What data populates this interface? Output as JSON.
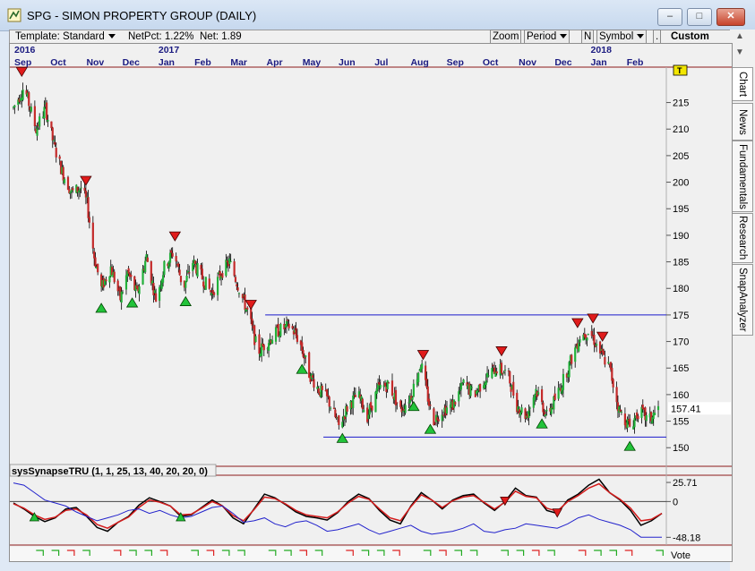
{
  "window": {
    "title": "SPG - SIMON PROPERTY GROUP (DAILY)",
    "minimize_label": "‒",
    "maximize_label": "□",
    "close_label": "✕"
  },
  "toolbar": {
    "template_label": "Template: Standard",
    "netpct_label": "NetPct: 1.22%",
    "net_label": "Net: 1.89",
    "zoom_label": "Zoom",
    "period_label": "Period",
    "n_label": "N",
    "symbol_label": "Symbol",
    "dot_label": ".",
    "custom_label": "Custom"
  },
  "side_tabs": [
    "Chart",
    "News",
    "Fundamentals",
    "Research",
    "SnapAnalyzer"
  ],
  "top_axis": {
    "years": [
      {
        "label": "2016",
        "index": 0
      },
      {
        "label": "2017",
        "index": 4
      },
      {
        "label": "2018",
        "index": 16
      }
    ],
    "months": [
      "Sep",
      "Oct",
      "Nov",
      "Dec",
      "Jan",
      "Feb",
      "Mar",
      "Apr",
      "May",
      "Jun",
      "Jul",
      "Aug",
      "Sep",
      "Oct",
      "Nov",
      "Dec",
      "Jan",
      "Feb"
    ]
  },
  "footer": {
    "vote_label": "Vote"
  },
  "t_marker": "T",
  "chart_data": [
    {
      "type": "candlestick",
      "title": "SPG - SIMON PROPERTY GROUP (DAILY)",
      "y_ticks": [
        150,
        155,
        160,
        165,
        170,
        175,
        180,
        185,
        190,
        195,
        200,
        205,
        210,
        215
      ],
      "ylim": [
        146.5,
        221.5
      ],
      "last_price_label": "157.41",
      "last_price": 157.41,
      "x_start": "2016-09",
      "x_end": "2018-02",
      "price_path": [
        [
          "2016-09-01",
          214
        ],
        [
          "2016-09-10",
          218
        ],
        [
          "2016-09-20",
          210
        ],
        [
          "2016-09-28",
          214
        ],
        [
          "2016-10-05",
          207
        ],
        [
          "2016-10-12",
          202
        ],
        [
          "2016-10-20",
          198
        ],
        [
          "2016-10-28",
          199
        ],
        [
          "2016-11-02",
          196
        ],
        [
          "2016-11-08",
          186
        ],
        [
          "2016-11-14",
          180
        ],
        [
          "2016-11-22",
          184
        ],
        [
          "2016-11-30",
          178
        ],
        [
          "2016-12-06",
          183
        ],
        [
          "2016-12-14",
          179
        ],
        [
          "2016-12-22",
          186
        ],
        [
          "2016-12-30",
          178
        ],
        [
          "2017-01-06",
          184
        ],
        [
          "2017-01-14",
          187
        ],
        [
          "2017-01-22",
          180
        ],
        [
          "2017-01-30",
          185
        ],
        [
          "2017-02-07",
          182
        ],
        [
          "2017-02-15",
          179
        ],
        [
          "2017-02-23",
          183
        ],
        [
          "2017-03-02",
          185
        ],
        [
          "2017-03-10",
          180
        ],
        [
          "2017-03-18",
          175
        ],
        [
          "2017-03-26",
          168
        ],
        [
          "2017-04-03",
          170
        ],
        [
          "2017-04-12",
          172
        ],
        [
          "2017-04-22",
          173
        ],
        [
          "2017-04-30",
          170
        ],
        [
          "2017-05-08",
          164
        ],
        [
          "2017-05-16",
          161
        ],
        [
          "2017-05-24",
          159
        ],
        [
          "2017-06-02",
          154
        ],
        [
          "2017-06-10",
          158
        ],
        [
          "2017-06-18",
          160
        ],
        [
          "2017-06-26",
          156
        ],
        [
          "2017-07-05",
          161
        ],
        [
          "2017-07-14",
          162
        ],
        [
          "2017-07-24",
          157
        ],
        [
          "2017-08-02",
          160
        ],
        [
          "2017-08-10",
          166
        ],
        [
          "2017-08-20",
          155
        ],
        [
          "2017-08-28",
          157
        ],
        [
          "2017-09-06",
          158
        ],
        [
          "2017-09-15",
          162
        ],
        [
          "2017-09-24",
          160
        ],
        [
          "2017-10-03",
          163
        ],
        [
          "2017-10-12",
          165
        ],
        [
          "2017-10-22",
          164
        ],
        [
          "2017-10-30",
          158
        ],
        [
          "2017-11-07",
          156
        ],
        [
          "2017-11-15",
          161
        ],
        [
          "2017-11-24",
          156
        ],
        [
          "2017-12-03",
          160
        ],
        [
          "2017-12-12",
          165
        ],
        [
          "2017-12-22",
          171
        ],
        [
          "2017-12-30",
          172
        ],
        [
          "2018-01-08",
          168
        ],
        [
          "2018-01-16",
          165
        ],
        [
          "2018-01-24",
          157
        ],
        [
          "2018-02-02",
          154
        ],
        [
          "2018-02-10",
          157
        ],
        [
          "2018-02-18",
          155
        ],
        [
          "2018-02-26",
          157.41
        ]
      ],
      "levels": [
        {
          "price": 175.0,
          "color": "#1a1acc",
          "from": "2017-04-01"
        },
        {
          "price": 152.0,
          "color": "#1a1acc",
          "from": "2017-05-20"
        }
      ],
      "sell_signals": [
        "2016-09-08",
        "2016-11-01",
        "2017-01-15",
        "2017-03-20",
        "2017-08-12",
        "2017-10-17",
        "2017-12-20",
        "2018-01-02",
        "2018-01-10"
      ],
      "buy_signals": [
        "2016-11-14",
        "2016-12-10",
        "2017-01-24",
        "2017-05-02",
        "2017-06-05",
        "2017-08-04",
        "2017-08-18",
        "2017-11-20",
        "2018-02-02"
      ],
      "colors": {
        "up": "#22b13a",
        "down": "#c42a2a",
        "wick": "#000000",
        "buy": "#22c33a",
        "sell": "#e01b1b"
      }
    },
    {
      "type": "line",
      "title": "sysSynapseTRU (1, 1, 25, 13, 40, 20, 20, 0)",
      "y_ticks": [
        25.71,
        0,
        -48.18
      ],
      "y_tick_labels": [
        "25.71",
        "0",
        "-48.18"
      ],
      "ylim": [
        -55,
        33
      ],
      "series": [
        {
          "color": "#000000",
          "values": [
            -2,
            -10,
            -20,
            -27,
            -22,
            -10,
            -8,
            -20,
            -35,
            -40,
            -28,
            -20,
            -5,
            5,
            0,
            -6,
            -20,
            -18,
            -8,
            2,
            -6,
            -22,
            -30,
            -10,
            10,
            5,
            -4,
            -14,
            -20,
            -22,
            -25,
            -15,
            0,
            10,
            4,
            -12,
            -25,
            -30,
            -6,
            12,
            2,
            -10,
            2,
            8,
            10,
            -2,
            -12,
            0,
            18,
            8,
            6,
            -12,
            -16,
            2,
            10,
            22,
            30,
            12,
            2,
            -12,
            -32,
            -26,
            -16
          ]
        },
        {
          "color": "#d41c1c",
          "values": [
            -3,
            -9,
            -18,
            -24,
            -21,
            -12,
            -10,
            -18,
            -31,
            -36,
            -28,
            -21,
            -8,
            2,
            -1,
            -6,
            -18,
            -17,
            -9,
            0,
            -6,
            -19,
            -26,
            -11,
            6,
            4,
            -3,
            -12,
            -18,
            -20,
            -22,
            -14,
            -2,
            7,
            3,
            -10,
            -22,
            -26,
            -7,
            9,
            2,
            -8,
            1,
            6,
            8,
            -1,
            -10,
            -1,
            14,
            7,
            5,
            -9,
            -13,
            0,
            8,
            18,
            24,
            12,
            3,
            -9,
            -26,
            -24,
            -16
          ]
        },
        {
          "color": "#2222cc",
          "values": [
            25,
            22,
            12,
            2,
            -2,
            -6,
            -14,
            -20,
            -26,
            -22,
            -18,
            -12,
            -10,
            -16,
            -12,
            -18,
            -22,
            -20,
            -14,
            -8,
            -6,
            -16,
            -28,
            -26,
            -22,
            -30,
            -34,
            -28,
            -26,
            -32,
            -40,
            -38,
            -34,
            -30,
            -38,
            -44,
            -40,
            -36,
            -32,
            -40,
            -44,
            -42,
            -40,
            -36,
            -30,
            -40,
            -42,
            -38,
            -36,
            -30,
            -32,
            -34,
            -36,
            -30,
            -22,
            -18,
            -24,
            -28,
            -32,
            -38,
            -48,
            -48,
            -48.18
          ]
        }
      ],
      "signals": {
        "buy": [
          2,
          16
        ],
        "sell": [
          47,
          52
        ]
      },
      "zero_line_color": "#444444"
    }
  ]
}
